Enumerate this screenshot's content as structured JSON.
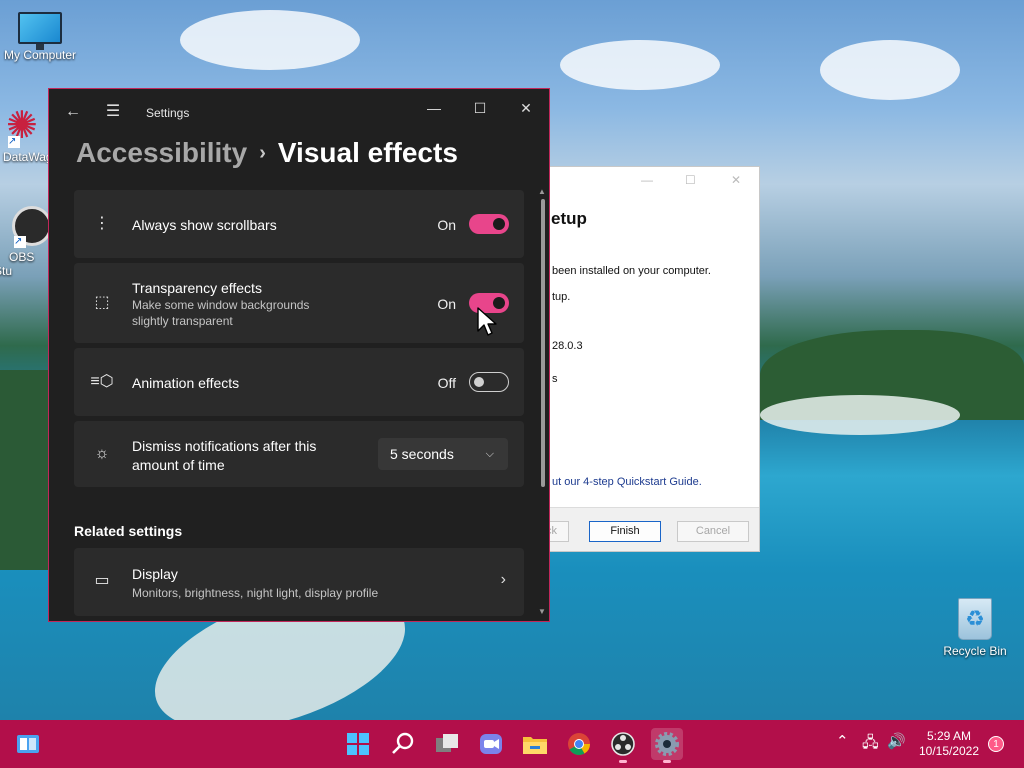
{
  "desktop": {
    "icons": [
      {
        "label": "My Computer",
        "glyph": "monitor-icon"
      },
      {
        "label": "DataWag",
        "glyph": "datawagon-icon"
      },
      {
        "label": "OBS Stu",
        "glyph": "obs-icon"
      },
      {
        "label": "Recycle Bin",
        "glyph": "recycle-bin-icon"
      }
    ]
  },
  "setup_window": {
    "title_partial": "etup",
    "lines": [
      "been installed on your computer.",
      "tup.",
      "28.0.3",
      "s",
      "ut our 4-step Quickstart Guide."
    ],
    "back_label": "ack",
    "finish_label": "Finish",
    "cancel_label": "Cancel"
  },
  "settings": {
    "title": "Settings",
    "breadcrumb": {
      "parent": "Accessibility",
      "separator": "›",
      "current": "Visual effects"
    },
    "cards": [
      {
        "id": "scrollbars",
        "label": "Always show scrollbars",
        "state": "On",
        "on": true,
        "icon": "scrollbar-icon"
      },
      {
        "id": "transparency",
        "label": "Transparency effects",
        "desc1": "Make some window backgrounds",
        "desc2": "slightly transparent",
        "state": "On",
        "on": true,
        "icon": "transparency-icon"
      },
      {
        "id": "animation",
        "label": "Animation effects",
        "state": "Off",
        "on": false,
        "icon": "animation-icon"
      },
      {
        "id": "notifications",
        "label1": "Dismiss notifications after this",
        "label2": "amount of time",
        "value": "5 seconds",
        "icon": "notification-icon"
      }
    ],
    "related_title": "Related settings",
    "display": {
      "label": "Display",
      "desc": "Monitors, brightness, night light, display profile",
      "icon": "laptop-icon"
    }
  },
  "taskbar": {
    "time": "5:29 AM",
    "date": "10/15/2022",
    "notification_count": "1",
    "apps": [
      "start-icon",
      "search-icon",
      "task-view-icon",
      "chat-icon",
      "file-explorer-icon",
      "chrome-icon",
      "obs-icon",
      "settings-icon"
    ],
    "active_app": "settings-icon"
  },
  "colors": {
    "accent": "#e8458b",
    "taskbar": "#b20f4a",
    "window_border": "#c1275a",
    "card": "#2b2b2b",
    "window_bg": "#202020"
  }
}
